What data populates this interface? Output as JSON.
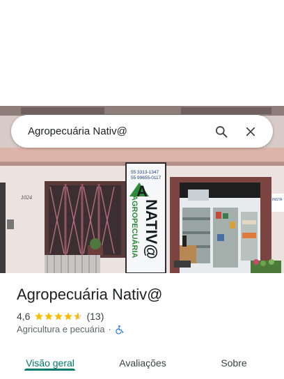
{
  "search": {
    "query": "Agropecuária Nativ@",
    "search_icon": "search-icon",
    "close_icon": "close-icon"
  },
  "photo": {
    "sign_phones": [
      "55 3313-1347",
      "55 99655-0117"
    ],
    "sign_logo_letter": "A",
    "sign_name": "NATIV@",
    "sign_vertical": "AGROPECUÁRIA",
    "house_number": "1024",
    "side_sign": "INSTA"
  },
  "place": {
    "name": "Agropecuária Nativ@",
    "rating": "4,6",
    "rating_value": 4.6,
    "review_count": "(13)",
    "category": "Agricultura e pecuária",
    "separator": "·",
    "accessibility_icon": "wheelchair-icon",
    "star_color": "#fbbc04",
    "accent_color": "#00796b"
  },
  "tabs": [
    {
      "label": "Visão geral",
      "active": true
    },
    {
      "label": "Avaliações",
      "active": false
    },
    {
      "label": "Sobre",
      "active": false
    }
  ]
}
